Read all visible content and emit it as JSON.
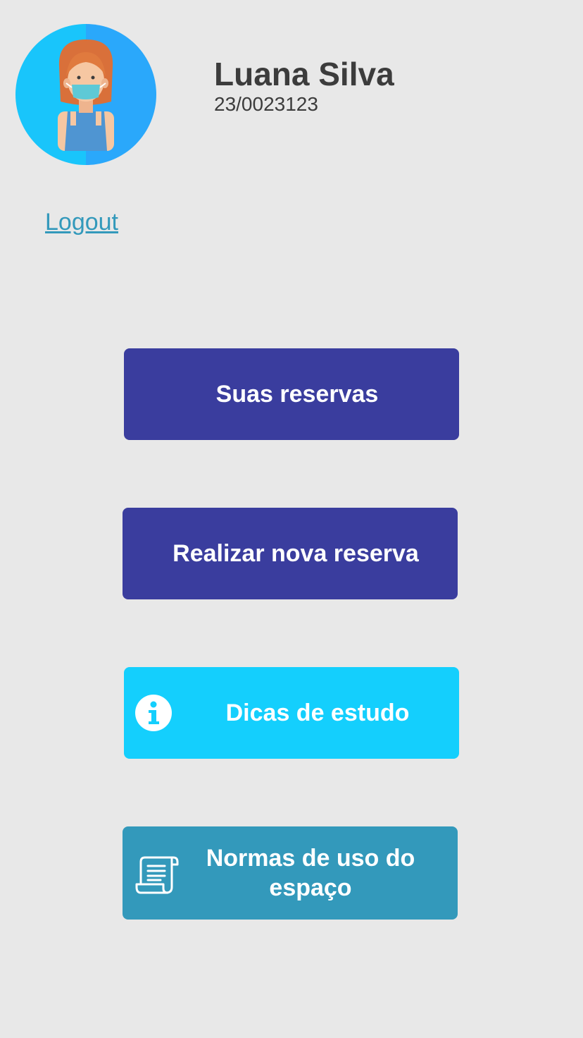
{
  "profile": {
    "avatar_icon": "user-avatar-woman-mask-icon",
    "name": "Luana Silva",
    "id": "23/0023123"
  },
  "logout_label": "Logout",
  "buttons": {
    "reservas": {
      "label": "Suas reservas"
    },
    "nova": {
      "label": "Realizar nova reserva"
    },
    "dicas": {
      "label": "Dicas de estudo",
      "icon": "info-icon"
    },
    "normas": {
      "label": "Normas de uso do espaço",
      "icon": "scroll-document-icon"
    }
  },
  "colors": {
    "background": "#e8e8e8",
    "primary": "#3a3d9e",
    "cyan": "#14cffd",
    "teal": "#3399bb",
    "text": "#3c3c3c"
  }
}
